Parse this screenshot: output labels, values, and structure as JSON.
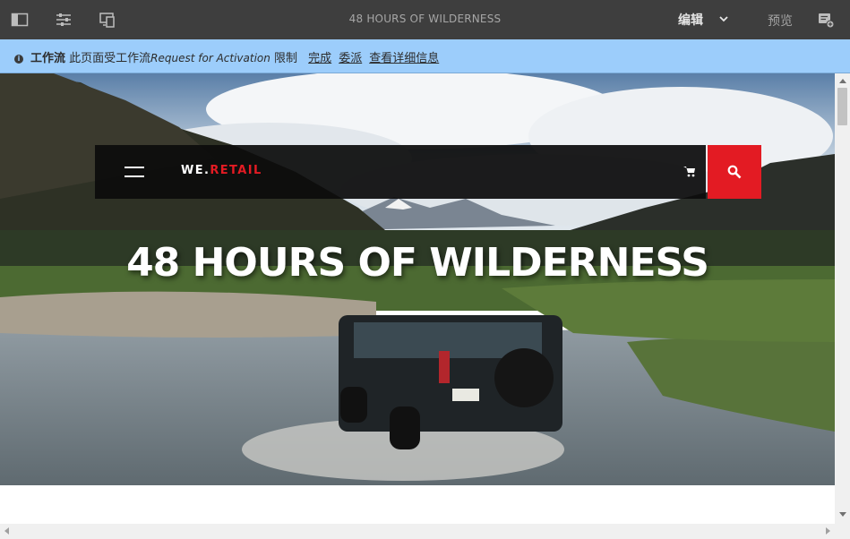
{
  "toolbar": {
    "page_title": "48 HOURS OF WILDERNESS",
    "mode_label": "编辑",
    "preview_label": "预览",
    "icons": [
      "side-panel-icon",
      "page-properties-icon",
      "emulator-icon",
      "annotate-icon"
    ]
  },
  "workflow_bar": {
    "label": "工作流",
    "text_before": "此页面受工作流",
    "workflow_name": "Request for Activation",
    "text_after": "限制",
    "actions": [
      "完成",
      "委派",
      "查看详细信息"
    ]
  },
  "site": {
    "logo_we": "WE.",
    "logo_retail": "RETAIL",
    "hero_title": "48 HOURS OF WILDERNESS",
    "brand_color": "#e31b23"
  }
}
